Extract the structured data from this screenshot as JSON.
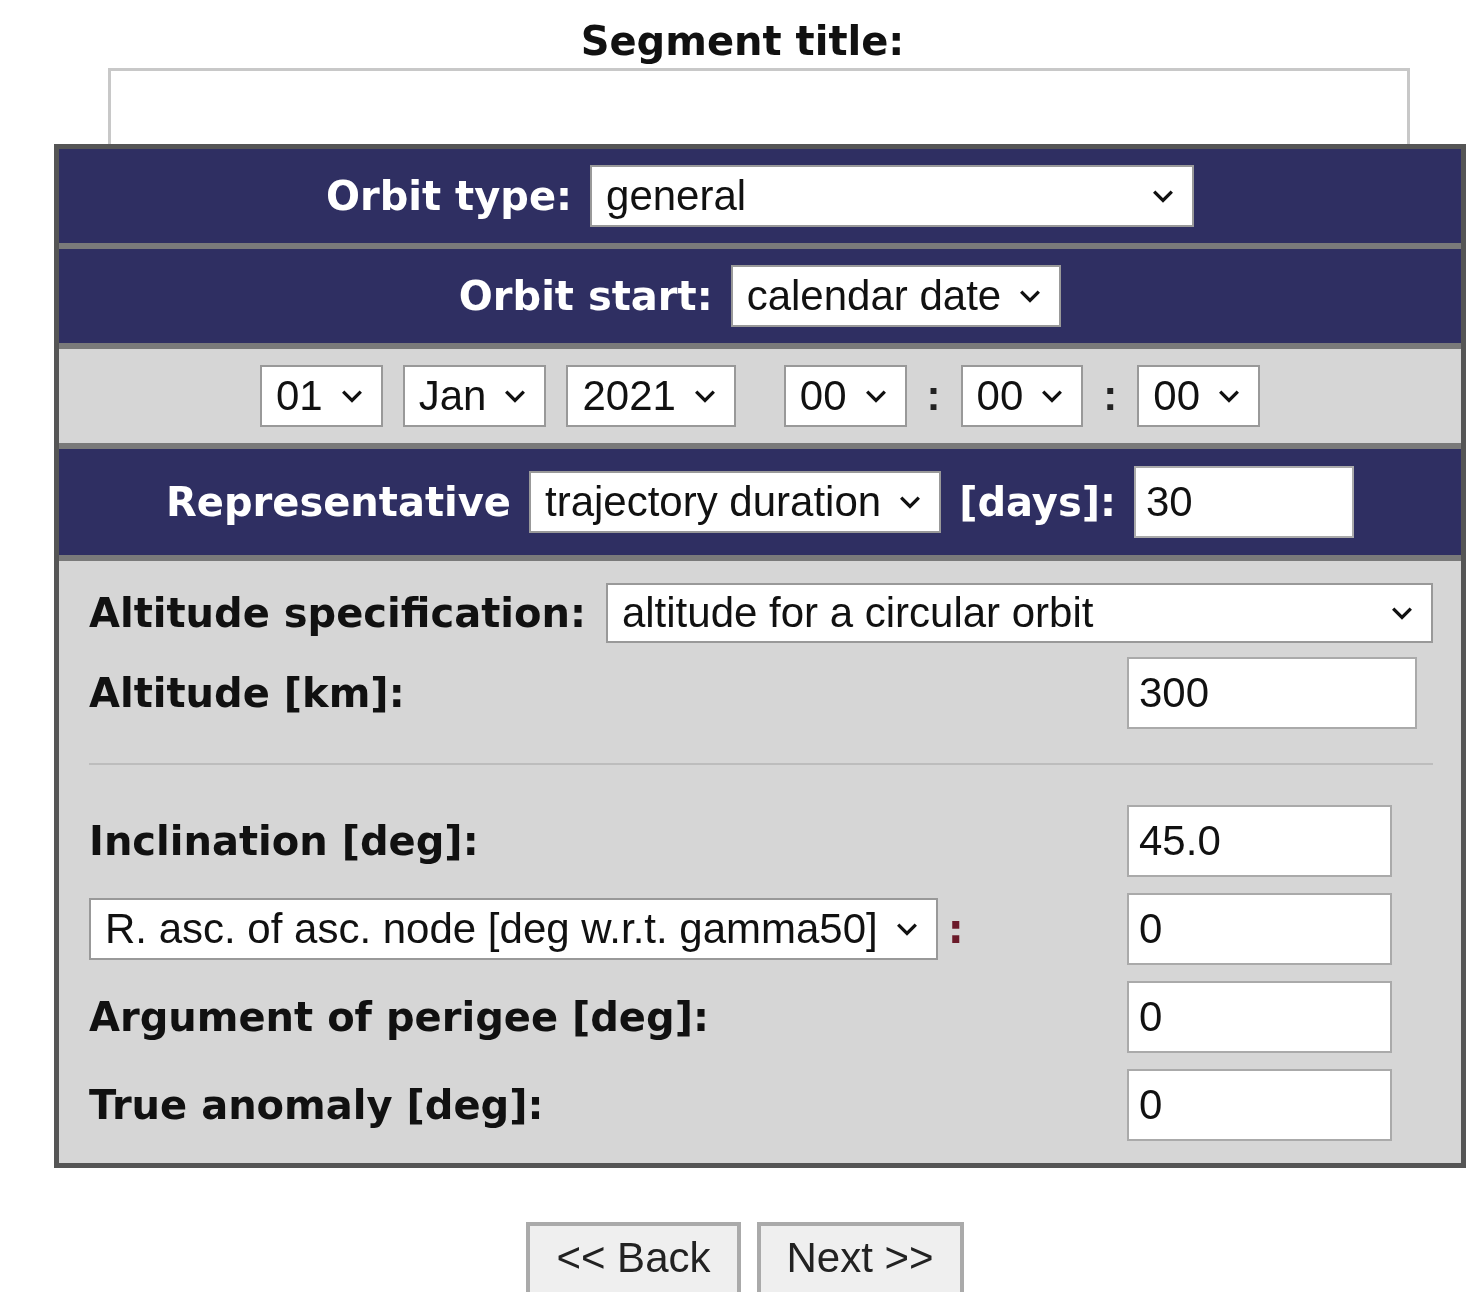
{
  "segment_title": {
    "label": "Segment title:"
  },
  "orbit_type": {
    "label": "Orbit type:",
    "value": "general"
  },
  "orbit_start": {
    "label": "Orbit start:",
    "value": "calendar date"
  },
  "date": {
    "day": "01",
    "month": "Jan",
    "year": "2021",
    "hour": "00",
    "minute": "00",
    "second": "00",
    "separators": [
      ":",
      ":"
    ]
  },
  "representative": {
    "label": "Representative",
    "select": "trajectory duration",
    "unit_label": "[days]:",
    "value": "30"
  },
  "altitude_spec": {
    "label": "Altitude specification:",
    "value": "altitude for a circular orbit"
  },
  "altitude": {
    "label": "Altitude [km]:",
    "value": "300"
  },
  "orbit_elements": [
    {
      "kind": "label",
      "label": "Inclination [deg]:",
      "value": "45.0"
    },
    {
      "kind": "select",
      "select": "R. asc. of asc. node [deg w.r.t. gamma50]",
      "suffix": ":",
      "value": "0"
    },
    {
      "kind": "label",
      "label": "Argument of perigee [deg]:",
      "value": "0"
    },
    {
      "kind": "label",
      "label": "True anomaly [deg]:",
      "value": "0"
    }
  ],
  "buttons": [
    "<< Back",
    "Next >>"
  ]
}
